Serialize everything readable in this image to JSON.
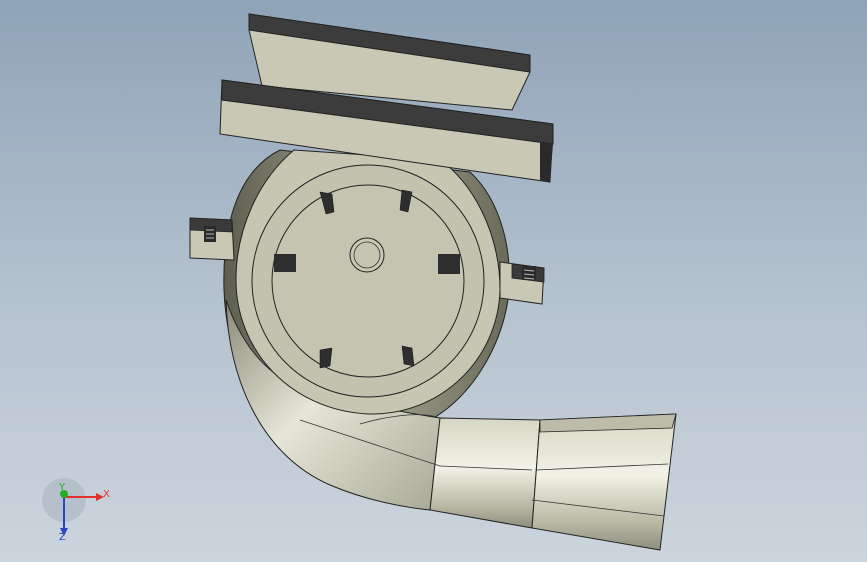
{
  "viewport": {
    "background_top": "#8fa3b8",
    "background_bottom": "#ccd5dd"
  },
  "model": {
    "body_color": "#c8c8b4",
    "face_color": "#c2c2ae",
    "dark_color": "#3a3a3a",
    "shadow_color": "#6e6e5e",
    "icon": "volute-pump-model"
  },
  "triad": {
    "x_label": "X",
    "y_label": "Y",
    "z_label": "Z",
    "x_color": "#e53030",
    "y_color": "#22b022",
    "z_color": "#2a44c8"
  }
}
